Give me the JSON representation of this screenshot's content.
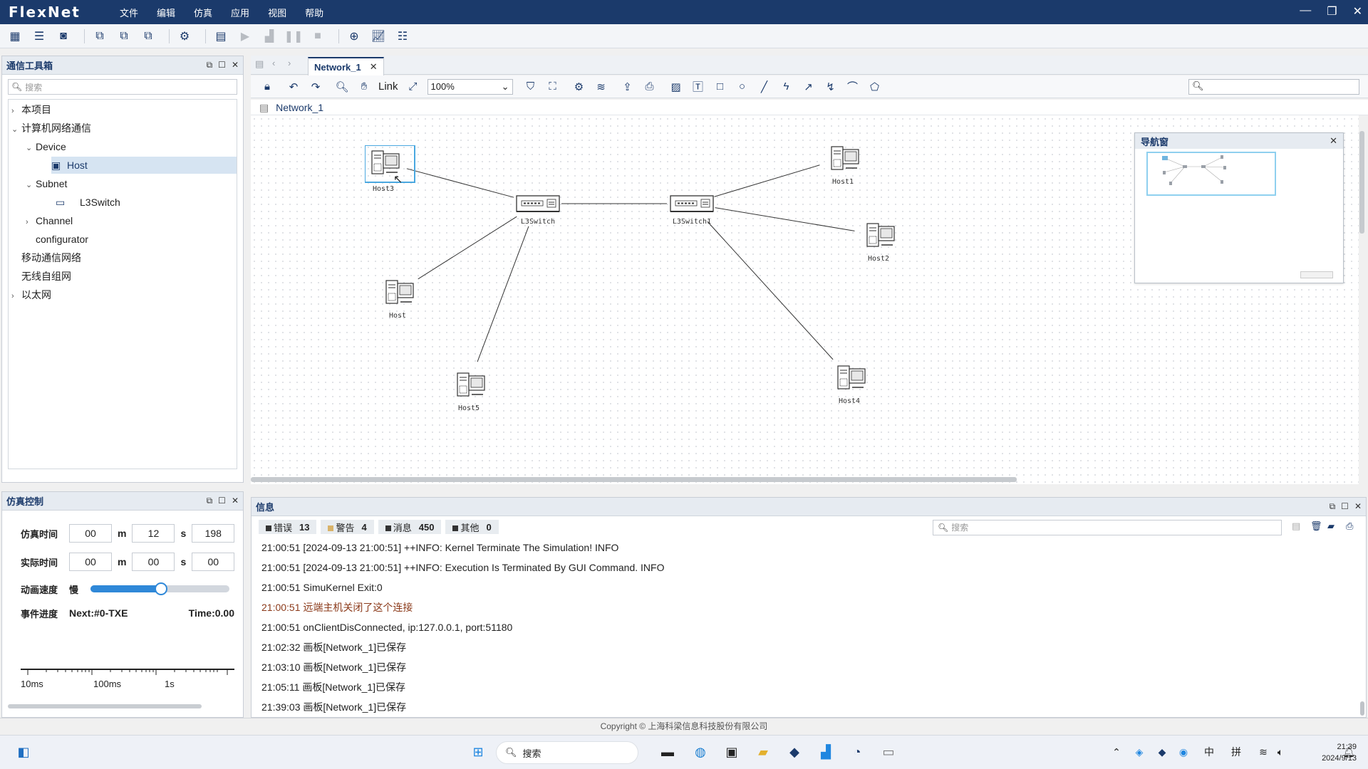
{
  "app": {
    "title": "FlexNet"
  },
  "menu": [
    "文件",
    "编辑",
    "仿真",
    "应用",
    "视图",
    "帮助"
  ],
  "toolbox": {
    "title": "通信工具箱",
    "search_placeholder": "搜索",
    "tree": [
      {
        "label": "本项目",
        "expanded": false
      },
      {
        "label": "计算机网络通信",
        "expanded": true
      },
      {
        "label": "Device",
        "expanded": true
      },
      {
        "label": "Host",
        "selected": true
      },
      {
        "label": "Subnet",
        "expanded": true
      },
      {
        "label": "L3Switch"
      },
      {
        "label": "Channel",
        "expanded": false
      },
      {
        "label": "configurator"
      },
      {
        "label": "移动通信网络"
      },
      {
        "label": "无线自组网"
      },
      {
        "label": "以太网",
        "expanded": false
      }
    ]
  },
  "sim_control": {
    "title": "仿真控制",
    "sim_time_label": "仿真时间",
    "sim_time": {
      "m_h": "00",
      "m": "12",
      "s": "198"
    },
    "real_time_label": "实际时间",
    "real_time": {
      "m_h": "00",
      "m": "00",
      "s": "00"
    },
    "units": {
      "m": "m",
      "s": "s"
    },
    "speed_label": "动画速度",
    "speed_slow": "慢",
    "speed_fraction": 0.51,
    "progress_label": "事件进度",
    "next_event": "Next:#0-TXE",
    "time_text": "Time:0.00",
    "scale_ticks": [
      "10ms",
      "100ms",
      "1s"
    ]
  },
  "editor": {
    "tab_label": "Network_1",
    "breadcrumb": "Network_1",
    "link_label": "Link",
    "zoom": "100%",
    "nodes": [
      {
        "id": "Host3",
        "label": "Host3",
        "kind": "host",
        "selected": true
      },
      {
        "id": "L3Switch",
        "label": "L3Switch",
        "kind": "switch"
      },
      {
        "id": "L3Switch1",
        "label": "L3Switch1",
        "kind": "switch"
      },
      {
        "id": "Host1",
        "label": "Host1",
        "kind": "host"
      },
      {
        "id": "Host2",
        "label": "Host2",
        "kind": "host"
      },
      {
        "id": "Host",
        "label": "Host",
        "kind": "host"
      },
      {
        "id": "Host5",
        "label": "Host5",
        "kind": "host"
      },
      {
        "id": "Host4",
        "label": "Host4",
        "kind": "host"
      }
    ],
    "links": [
      [
        "Host3",
        "L3Switch"
      ],
      [
        "Host",
        "L3Switch"
      ],
      [
        "Host5",
        "L3Switch"
      ],
      [
        "L3Switch",
        "L3Switch1"
      ],
      [
        "L3Switch1",
        "Host1"
      ],
      [
        "L3Switch1",
        "Host2"
      ],
      [
        "L3Switch1",
        "Host4"
      ]
    ]
  },
  "navigator": {
    "title": "导航窗"
  },
  "info": {
    "title": "信息",
    "filters": [
      {
        "label": "错误",
        "count": "13",
        "color": "#333333"
      },
      {
        "label": "警告",
        "count": "4",
        "color": "#d9b36a"
      },
      {
        "label": "消息",
        "count": "450",
        "color": "#333333"
      },
      {
        "label": "其他",
        "count": "0",
        "color": "#333333"
      }
    ],
    "search_placeholder": "搜索",
    "log": [
      {
        "text": "21:00:51 [2024-09-13 21:00:51] ++INFO: Kernel Terminate The Simulation! INFO",
        "color": "#222222"
      },
      {
        "text": "21:00:51 [2024-09-13 21:00:51] ++INFO: Execution Is Terminated By GUI Command. INFO",
        "color": "#222222"
      },
      {
        "text": "21:00:51 SimuKernel Exit:0",
        "color": "#222222"
      },
      {
        "text": "21:00:51 远端主机关闭了这个连接",
        "color": "#8b3a1a"
      },
      {
        "text": "21:00:51 onClientDisConnected, ip:127.0.0.1, port:51180",
        "color": "#222222"
      },
      {
        "text": "21:02:32 画板[Network_1]已保存",
        "color": "#222222"
      },
      {
        "text": "21:03:10 画板[Network_1]已保存",
        "color": "#222222"
      },
      {
        "text": "21:05:11 画板[Network_1]已保存",
        "color": "#222222"
      },
      {
        "text": "21:39:03 画板[Network_1]已保存",
        "color": "#222222"
      }
    ]
  },
  "status": {
    "copyright": "Copyright © 上海科梁信息科技股份有限公司"
  },
  "taskbar": {
    "search_label": "搜索",
    "time": "21:39",
    "date": "2024/9/13",
    "ime_lang": "中",
    "ime_mode": "拼"
  }
}
